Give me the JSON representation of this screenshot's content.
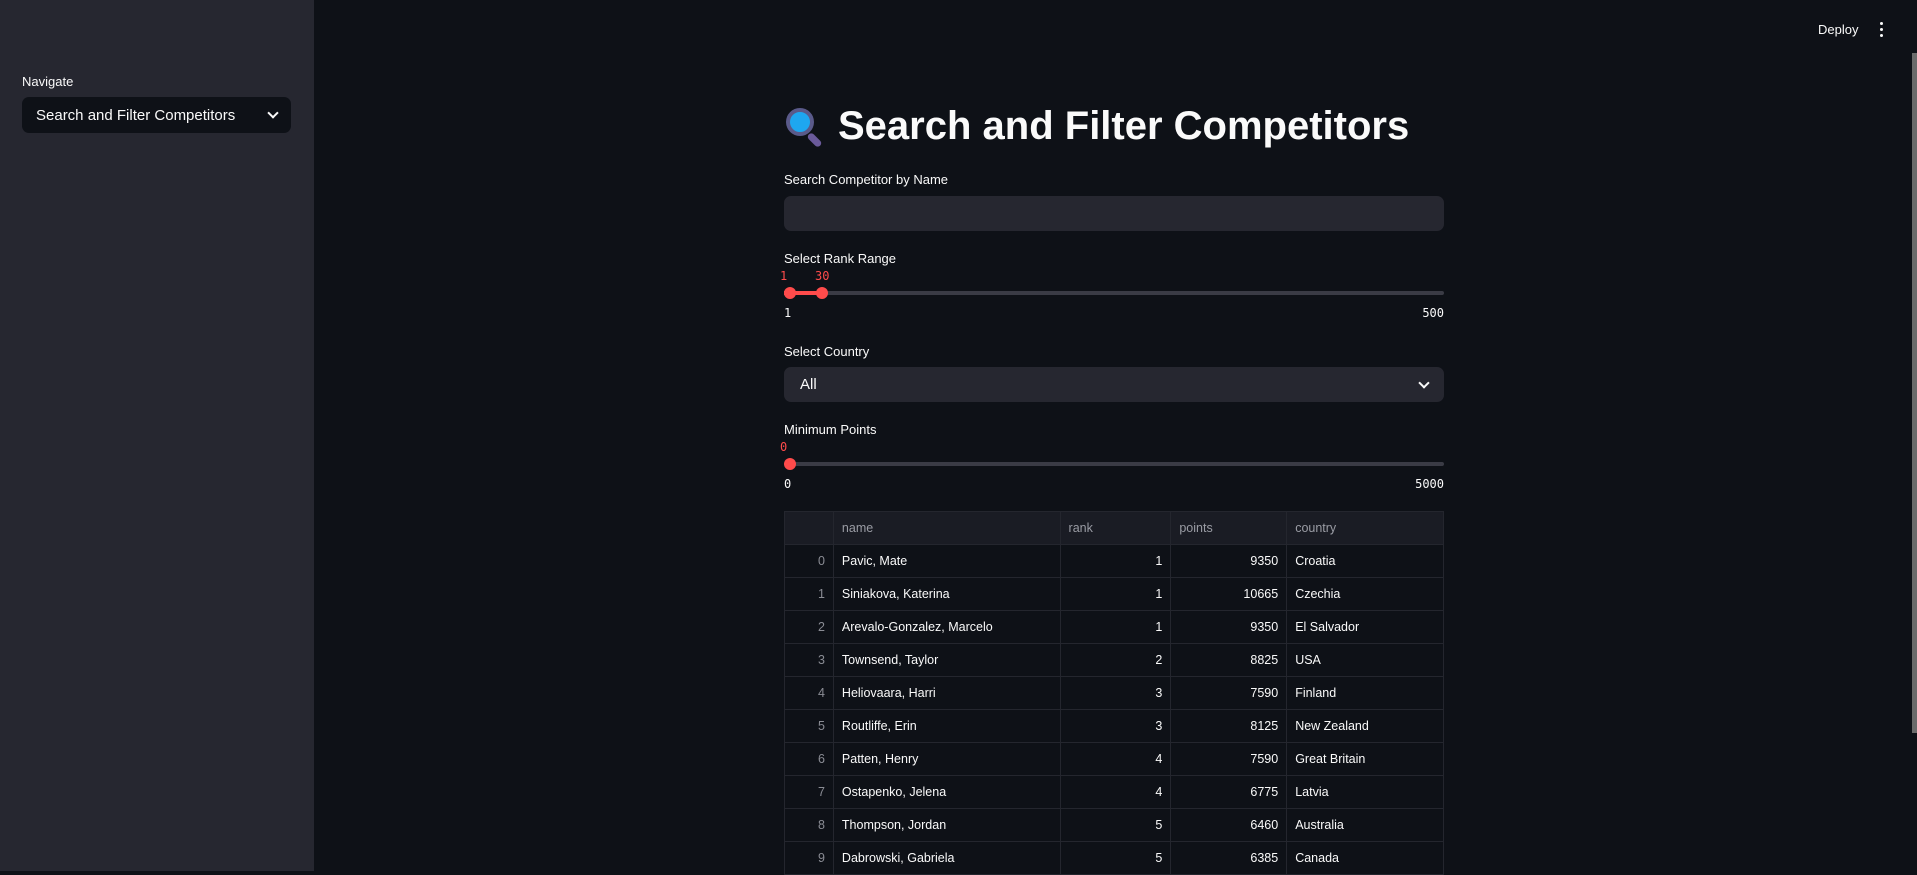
{
  "sidebar": {
    "nav_label": "Navigate",
    "nav_value": "Search and Filter Competitors"
  },
  "header": {
    "deploy": "Deploy"
  },
  "main": {
    "title": "Search and Filter Competitors",
    "search": {
      "label": "Search Competitor by Name",
      "value": ""
    },
    "rank": {
      "label": "Select Rank Range",
      "low": 1,
      "high": 30,
      "min": 1,
      "max": 500
    },
    "country": {
      "label": "Select Country",
      "value": "All"
    },
    "points": {
      "label": "Minimum Points",
      "value": 0,
      "min": 0,
      "max": 5000
    },
    "table": {
      "columns": [
        "",
        "name",
        "rank",
        "points",
        "country"
      ],
      "rows": [
        [
          "0",
          "Pavic, Mate",
          "1",
          "9350",
          "Croatia"
        ],
        [
          "1",
          "Siniakova, Katerina",
          "1",
          "10665",
          "Czechia"
        ],
        [
          "2",
          "Arevalo-Gonzalez, Marcelo",
          "1",
          "9350",
          "El Salvador"
        ],
        [
          "3",
          "Townsend, Taylor",
          "2",
          "8825",
          "USA"
        ],
        [
          "4",
          "Heliovaara, Harri",
          "3",
          "7590",
          "Finland"
        ],
        [
          "5",
          "Routliffe, Erin",
          "3",
          "8125",
          "New Zealand"
        ],
        [
          "6",
          "Patten, Henry",
          "4",
          "7590",
          "Great Britain"
        ],
        [
          "7",
          "Ostapenko, Jelena",
          "4",
          "6775",
          "Latvia"
        ],
        [
          "8",
          "Thompson, Jordan",
          "5",
          "6460",
          "Australia"
        ],
        [
          "9",
          "Dabrowski, Gabriela",
          "5",
          "6385",
          "Canada"
        ]
      ]
    }
  }
}
